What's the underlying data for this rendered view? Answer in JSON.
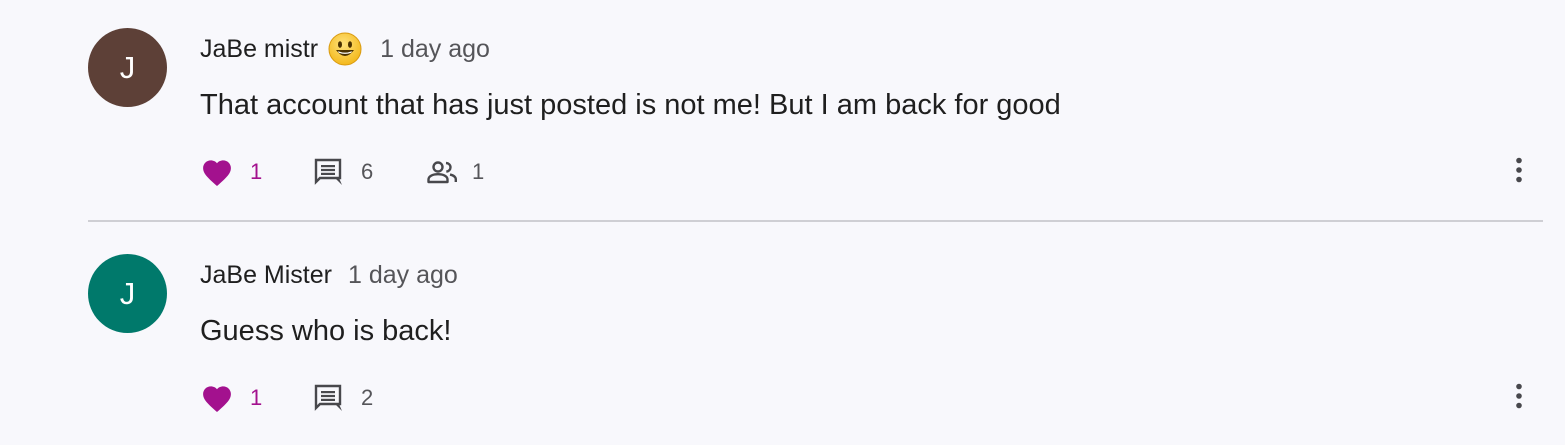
{
  "posts": [
    {
      "avatar_initial": "J",
      "avatar_color": "#5d4037",
      "author": "JaBe mistr",
      "has_emoji_badge": true,
      "emoji_badge_icon": "smiley-face-icon",
      "timestamp": "1 day ago",
      "text": "That account that has just posted is not me! But I am back for good",
      "likes": "1",
      "comments": "6",
      "participants": "1"
    },
    {
      "avatar_initial": "J",
      "avatar_color": "#00796b",
      "author": "JaBe Mister",
      "has_emoji_badge": false,
      "timestamp": "1 day ago",
      "text": "Guess who is back!",
      "likes": "1",
      "comments": "2"
    }
  ],
  "colors": {
    "like_accent": "#a3118e",
    "icon_gray": "#48484c",
    "divider": "#cfcfd4",
    "background": "#f8f8fc"
  },
  "icons": {
    "like": "heart-icon",
    "comment": "comment-icon",
    "participants": "people-icon",
    "more": "more-vertical-icon"
  }
}
